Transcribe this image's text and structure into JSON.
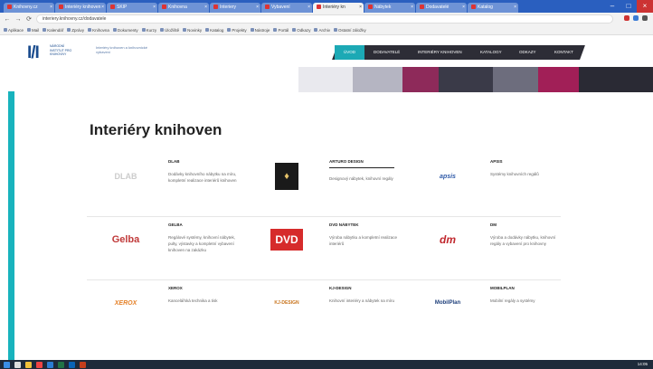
{
  "browser": {
    "tabs": [
      {
        "label": "Knihovny.cz",
        "active": false
      },
      {
        "label": "Interiéry knihoven",
        "active": false
      },
      {
        "label": "SKIP",
        "active": false
      },
      {
        "label": "Knihovna",
        "active": false
      },
      {
        "label": "Interiery",
        "active": false
      },
      {
        "label": "Vybavení",
        "active": false
      },
      {
        "label": "Interiéry kn",
        "active": true
      },
      {
        "label": "Nábytek",
        "active": false
      },
      {
        "label": "Dodavatelé",
        "active": false
      },
      {
        "label": "Katalog",
        "active": false
      }
    ],
    "address": "interiery.knihovny.cz/dodavatele",
    "bookmarks": [
      "Aplikace",
      "Mail",
      "Kalendář",
      "Zprávy",
      "Knihovna",
      "Dokumenty",
      "Kurzy",
      "Úložiště",
      "Novinky",
      "Katalog",
      "Projekty",
      "Nástroje",
      "Portál",
      "Odkazy",
      "Archiv",
      "Ostatní záložky"
    ]
  },
  "site": {
    "logo_mark": "I/I",
    "logo_text": "NÁRODNÍ INSTITUT PRO KNIHOVNY",
    "org_text": "Interiéry knihoven a knihovnické vybavení",
    "nav": [
      {
        "label": "ÚVOD",
        "active": true
      },
      {
        "label": "DODAVATELÉ",
        "active": false
      },
      {
        "label": "INTERIÉRY KNIHOVEN",
        "active": false
      },
      {
        "label": "KATALOGY",
        "active": false
      },
      {
        "label": "ODKAZY",
        "active": false
      },
      {
        "label": "KONTAKT",
        "active": false
      }
    ]
  },
  "page": {
    "title": "Interiéry knihoven"
  },
  "suppliers": [
    [
      {
        "name": "DLAB",
        "desc": "Dodávky knihovního nábytku na míru, kompletní realizace interiérů knihoven",
        "logo": "dlab",
        "logo_text": "DLAB"
      },
      {
        "name": "ARTURO DESIGN",
        "desc": "Designový nábytek, knihovní regály",
        "logo": "box",
        "logo_text": "♦"
      },
      {
        "name": "APSIS",
        "desc": "Systémy knihovních regálů",
        "logo": "apsis",
        "logo_text": "apsis"
      }
    ],
    [
      {
        "name": "GELBA",
        "desc": "Regálové systémy, knihovní nábytek, pulty, výstavky a kompletní vybavení knihoven na zakázku",
        "logo": "gelba",
        "logo_text": "Gelba"
      },
      {
        "name": "DVD NÁBYTEK",
        "desc": "Výroba nábytku a kompletní realizace interiérů",
        "logo": "dvd",
        "logo_text": "DVD"
      },
      {
        "name": "DM",
        "desc": "Výroba a dodávky nábytku, knihovní regály a vybavení pro knihovny",
        "logo": "dm",
        "logo_text": "dm"
      }
    ],
    [
      {
        "name": "XEROX",
        "desc": "Kancelářská technika a tisk",
        "logo": "xr",
        "logo_text": "XEROX"
      },
      {
        "name": "KJ-DESIGN",
        "desc": "Knihovní interiéry a nábytek na míru",
        "logo": "kj",
        "logo_text": "KJ-DESIGN"
      },
      {
        "name": "MOBILPLAN",
        "desc": "Mobilní regály a systémy",
        "logo": "mp",
        "logo_text": "MobilPlan"
      }
    ]
  ],
  "taskbar": {
    "clock": "14:05"
  }
}
